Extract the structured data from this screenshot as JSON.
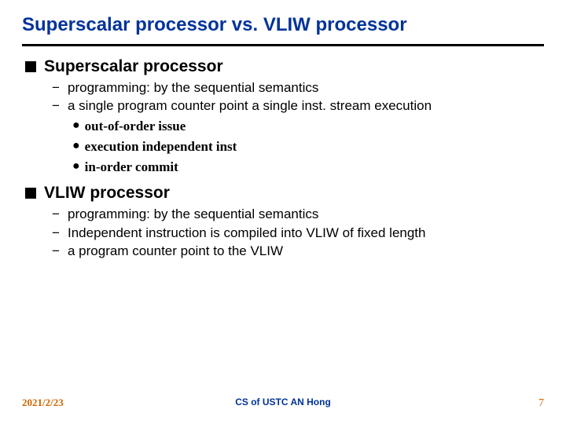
{
  "title": "Superscalar processor vs. VLIW processor",
  "sections": [
    {
      "heading": "Superscalar processor",
      "dash": [
        "programming: by the sequential semantics",
        "a single program counter point a single inst. stream execution"
      ],
      "dot": [
        "out-of-order issue",
        "execution independent inst",
        "in-order commit"
      ]
    },
    {
      "heading": "VLIW processor",
      "dash": [
        "programming: by the sequential semantics",
        "Independent instruction is compiled into VLIW of fixed length",
        "a program counter point to the VLIW"
      ],
      "dot": []
    }
  ],
  "footer": {
    "date": "2021/2/23",
    "center": "CS of USTC AN Hong",
    "page": "7"
  }
}
